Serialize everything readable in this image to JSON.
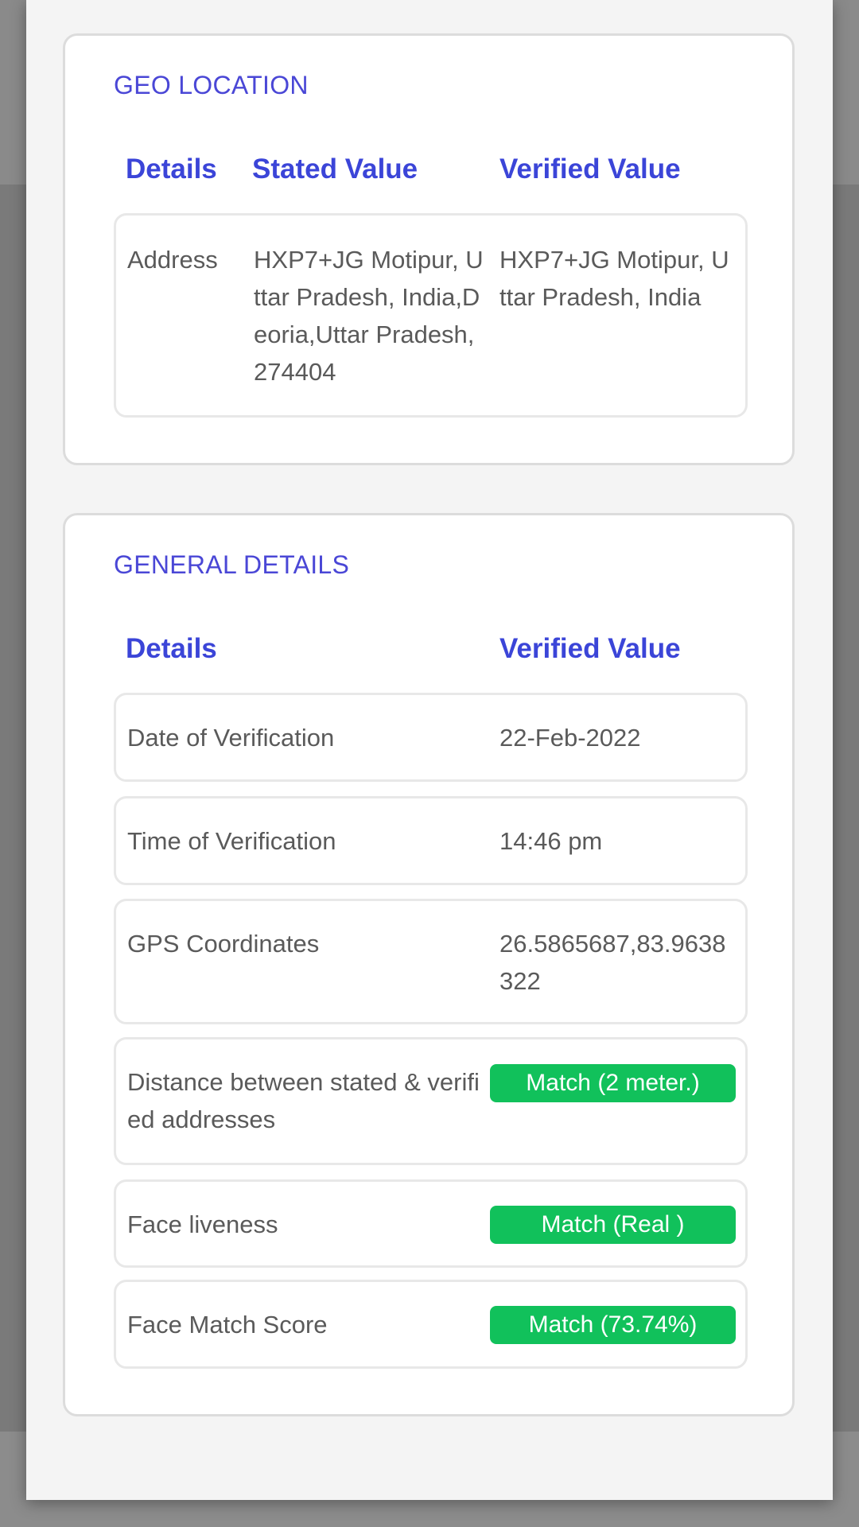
{
  "geo_location": {
    "title": "GEO LOCATION",
    "headers": {
      "details": "Details",
      "stated": "Stated Value",
      "verified": "Verified Value"
    },
    "rows": [
      {
        "label": "Address",
        "stated": "HXP7+JG Motipur, Uttar Pradesh, India,Deoria,Uttar Pradesh,274404",
        "verified": "HXP7+JG Motipur, Uttar Pradesh, India"
      }
    ]
  },
  "general_details": {
    "title": "GENERAL DETAILS",
    "headers": {
      "details": "Details",
      "verified": "Verified Value"
    },
    "rows": [
      {
        "label": "Date of Verification",
        "value": "22-Feb-2022"
      },
      {
        "label": "Time of Verification",
        "value": "14:46 pm"
      },
      {
        "label": "GPS Coordinates",
        "value": "26.5865687,83.9638322"
      },
      {
        "label": "Distance between stated & verified addresses",
        "value": "Match (2 meter.)",
        "badge": true
      },
      {
        "label": "Face liveness",
        "value": "Match (Real )",
        "badge": true
      },
      {
        "label": "Face Match Score",
        "value": "Match (73.74%)",
        "badge": true
      }
    ]
  },
  "colors": {
    "accent": "#3b45d8",
    "match_green": "#11c15b",
    "text": "#5a5a5a",
    "card_border": "#dcdcdc"
  }
}
